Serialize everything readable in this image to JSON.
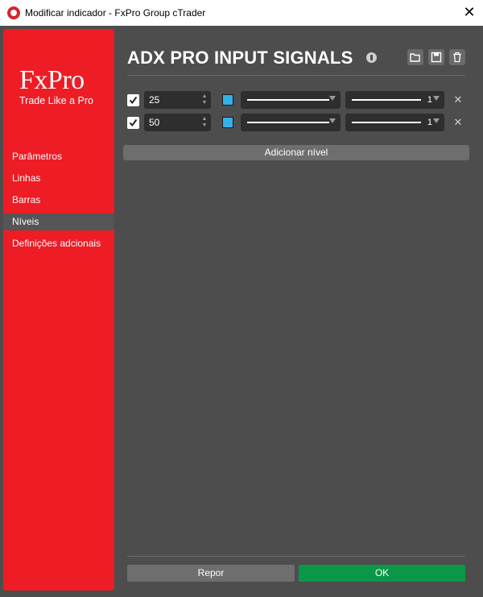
{
  "window": {
    "title": "Modificar indicador - FxPro Group cTrader",
    "close_symbol": "✕"
  },
  "brand": {
    "logo": "FxPro",
    "tagline": "Trade Like a Pro",
    "color": "#ee1c25"
  },
  "sidebar": {
    "items": [
      {
        "label": "Parâmetros"
      },
      {
        "label": "Linhas"
      },
      {
        "label": "Barras"
      },
      {
        "label": "Níveis",
        "active": true
      },
      {
        "label": "Definições adcionais"
      }
    ]
  },
  "header": {
    "title": "ADX PRO INPUT SIGNALS",
    "icons": [
      "info-icon",
      "open-folder-icon",
      "save-icon",
      "trash-icon"
    ]
  },
  "levels": [
    {
      "checked": true,
      "value": "25",
      "color": "#35b1e6",
      "line_style": "solid",
      "thickness": "1"
    },
    {
      "checked": true,
      "value": "50",
      "color": "#35b1e6",
      "line_style": "solid",
      "thickness": "1"
    }
  ],
  "actions": {
    "add_level": "Adicionar nível",
    "reset": "Repor",
    "ok": "OK"
  },
  "colors": {
    "background": "#4d4d4d",
    "input": "#2e2e2e",
    "ok": "#0a9747"
  }
}
